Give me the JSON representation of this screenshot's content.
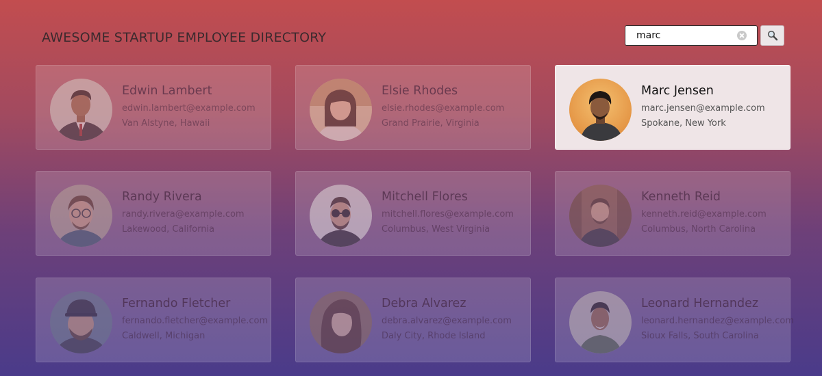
{
  "header": {
    "title": "AWESOME STARTUP EMPLOYEE DIRECTORY"
  },
  "search": {
    "value": "marc",
    "clear_icon": "clear-circle-icon",
    "button_icon": "magnifier-icon"
  },
  "employees": [
    {
      "name": "Edwin Lambert",
      "email": "edwin.lambert@example.com",
      "location": "Van Alstyne, Hawaii",
      "highlighted": false
    },
    {
      "name": "Elsie Rhodes",
      "email": "elsie.rhodes@example.com",
      "location": "Grand Prairie, Virginia",
      "highlighted": false
    },
    {
      "name": "Marc Jensen",
      "email": "marc.jensen@example.com",
      "location": "Spokane, New York",
      "highlighted": true
    },
    {
      "name": "Randy Rivera",
      "email": "randy.rivera@example.com",
      "location": "Lakewood, California",
      "highlighted": false
    },
    {
      "name": "Mitchell Flores",
      "email": "mitchell.flores@example.com",
      "location": "Columbus, West Virginia",
      "highlighted": false
    },
    {
      "name": "Kenneth Reid",
      "email": "kenneth.reid@example.com",
      "location": "Columbus, North Carolina",
      "highlighted": false
    },
    {
      "name": "Fernando Fletcher",
      "email": "fernando.fletcher@example.com",
      "location": "Caldwell, Michigan",
      "highlighted": false
    },
    {
      "name": "Debra Alvarez",
      "email": "debra.alvarez@example.com",
      "location": "Daly City, Rhode Island",
      "highlighted": false
    },
    {
      "name": "Leonard Hernandez",
      "email": "leonard.hernandez@example.com",
      "location": "Sioux Falls, South Carolina",
      "highlighted": false
    }
  ],
  "colors": {
    "background_top": "#c24d4f",
    "background_bottom": "#4a3b8a",
    "card_highlight": "#efe5e7"
  }
}
